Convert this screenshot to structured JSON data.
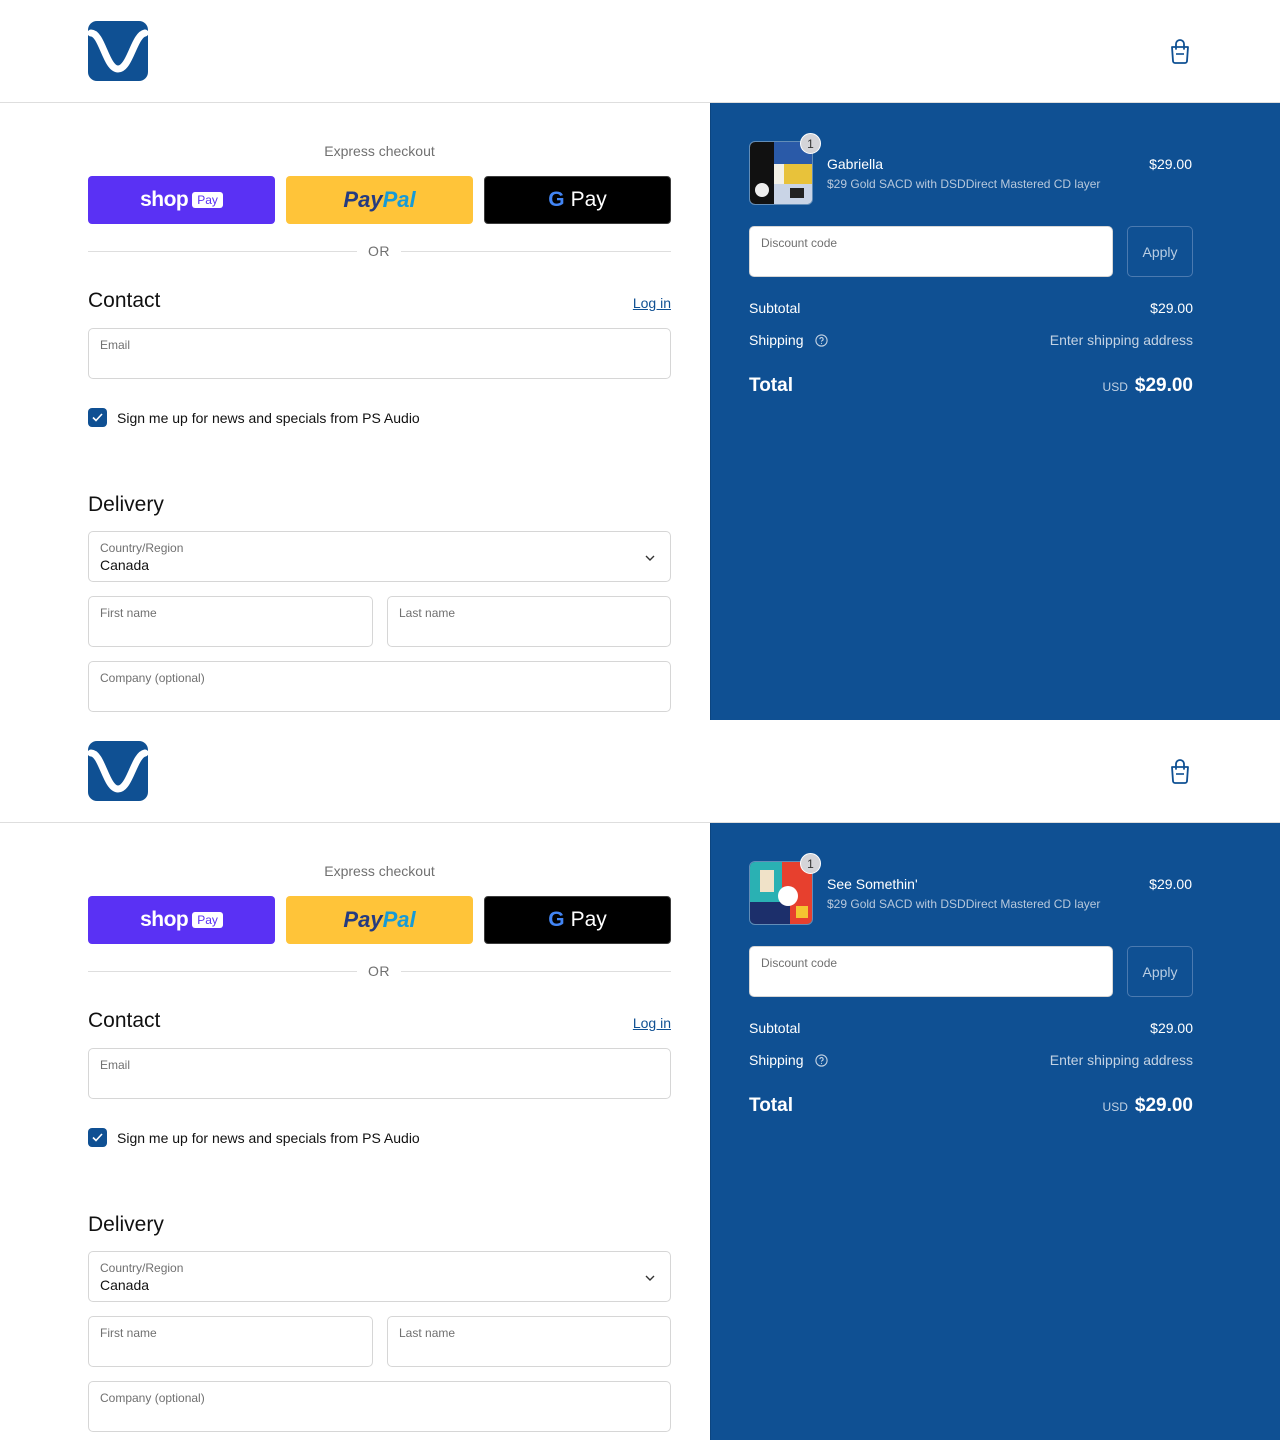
{
  "colors": {
    "brand": "#0f5093",
    "shop_pay": "#5a31f4",
    "paypal": "#ffc439",
    "gpay": "#000000"
  },
  "panels": [
    {
      "express_title": "Express checkout",
      "shop_pay": {
        "word": "shop",
        "badge": "Pay"
      },
      "paypal": {
        "pay": "Pay",
        "pal": "Pal"
      },
      "gpay": {
        "g": "G",
        "label": "Pay"
      },
      "or_text": "OR",
      "contact": {
        "title": "Contact",
        "login": "Log in",
        "email_label": "Email"
      },
      "newsletter": "Sign me up for news and specials from PS Audio",
      "delivery": {
        "title": "Delivery",
        "country_label": "Country/Region",
        "country_value": "Canada",
        "first_name_label": "First name",
        "last_name_label": "Last name",
        "company_label": "Company (optional)"
      },
      "summary": {
        "quantity": "1",
        "product_name": "Gabriella",
        "variant": "$29 Gold SACD with DSDDirect Mastered CD layer",
        "price": "$29.00",
        "discount_label": "Discount code",
        "apply": "Apply",
        "subtotal_label": "Subtotal",
        "subtotal_value": "$29.00",
        "shipping_label": "Shipping",
        "shipping_value": "Enter shipping address",
        "total_label": "Total",
        "currency": "USD",
        "total_value": "$29.00"
      }
    },
    {
      "express_title": "Express checkout",
      "shop_pay": {
        "word": "shop",
        "badge": "Pay"
      },
      "paypal": {
        "pay": "Pay",
        "pal": "Pal"
      },
      "gpay": {
        "g": "G",
        "label": "Pay"
      },
      "or_text": "OR",
      "contact": {
        "title": "Contact",
        "login": "Log in",
        "email_label": "Email"
      },
      "newsletter": "Sign me up for news and specials from PS Audio",
      "delivery": {
        "title": "Delivery",
        "country_label": "Country/Region",
        "country_value": "Canada",
        "first_name_label": "First name",
        "last_name_label": "Last name",
        "company_label": "Company (optional)"
      },
      "summary": {
        "quantity": "1",
        "product_name": "See Somethin'",
        "variant": "$29 Gold SACD with DSDDirect Mastered CD layer",
        "price": "$29.00",
        "discount_label": "Discount code",
        "apply": "Apply",
        "subtotal_label": "Subtotal",
        "subtotal_value": "$29.00",
        "shipping_label": "Shipping",
        "shipping_value": "Enter shipping address",
        "total_label": "Total",
        "currency": "USD",
        "total_value": "$29.00"
      }
    }
  ]
}
